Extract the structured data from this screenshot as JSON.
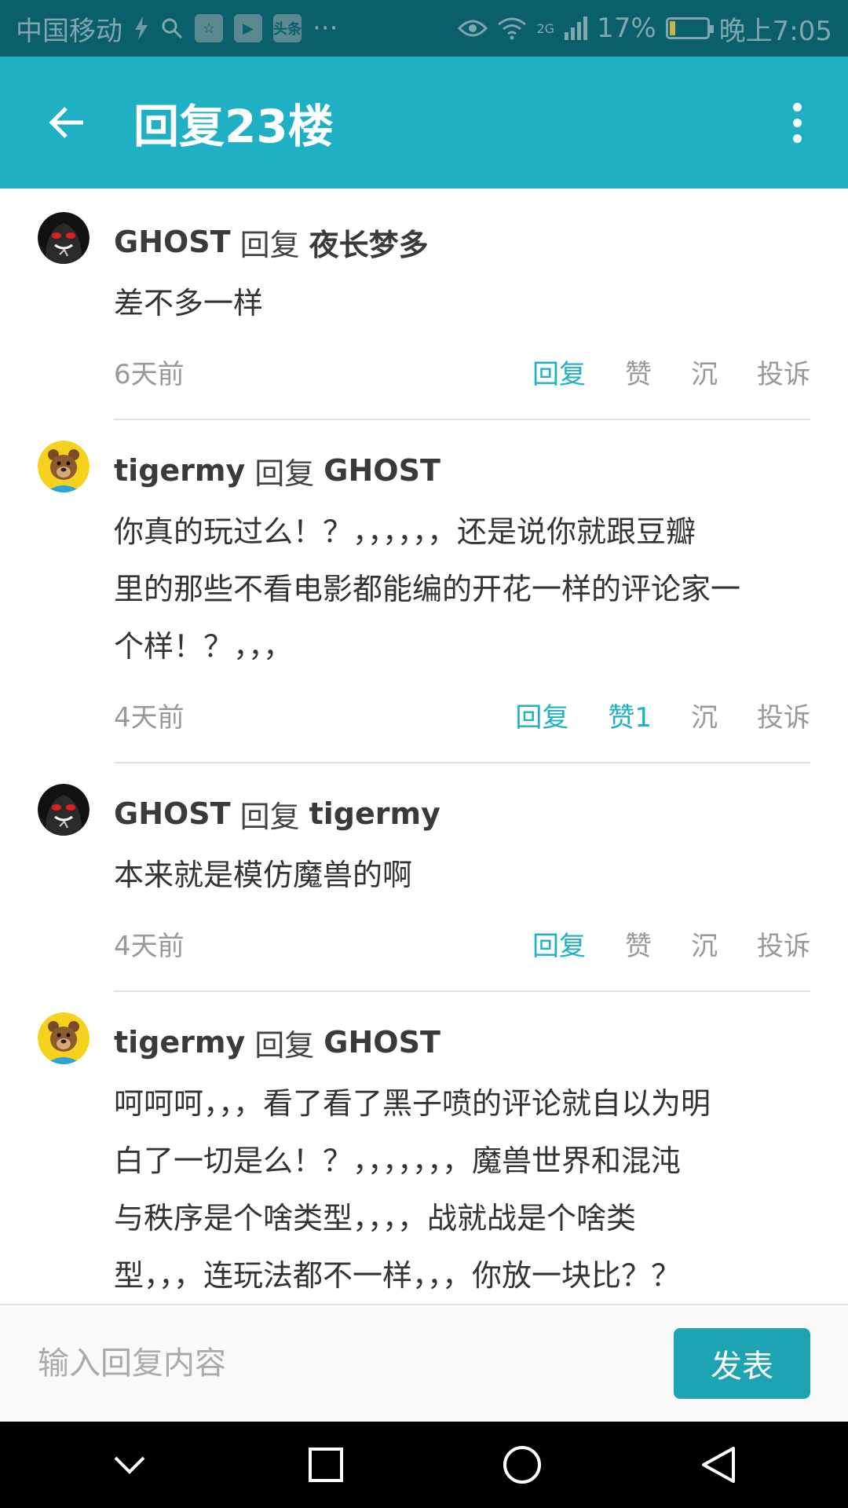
{
  "status_bar": {
    "carrier": "中国移动",
    "app_badges": [
      "☆",
      "▶",
      "头条"
    ],
    "more": "···",
    "network": "2G",
    "battery": "17%",
    "battery_level": 0.17,
    "time": "晚上7:05"
  },
  "header": {
    "title": "回复23楼"
  },
  "comments": [
    {
      "author": "GHOST",
      "reply_word": "回复",
      "target": "夜长梦多",
      "text": "差不多一样",
      "time": "6天前",
      "actions": {
        "reply": "回复",
        "like": "赞",
        "sink": "沉",
        "report": "投诉"
      },
      "like_active": false,
      "avatar": "ghost"
    },
    {
      "author": "tigermy",
      "reply_word": "回复",
      "target": "GHOST",
      "text_lines": [
        "你真的玩过么！？，，，，，，还是说你就跟豆瓣",
        "里的那些不看电影都能编的开花一样的评论家一",
        "个样！？，，，"
      ],
      "time": "4天前",
      "actions": {
        "reply": "回复",
        "like": "赞1",
        "sink": "沉",
        "report": "投诉"
      },
      "like_active": true,
      "avatar": "bear"
    },
    {
      "author": "GHOST",
      "reply_word": "回复",
      "target": "tigermy",
      "text": "本来就是模仿魔兽的啊",
      "time": "4天前",
      "actions": {
        "reply": "回复",
        "like": "赞",
        "sink": "沉",
        "report": "投诉"
      },
      "like_active": false,
      "avatar": "ghost"
    },
    {
      "author": "tigermy",
      "reply_word": "回复",
      "target": "GHOST",
      "text_lines": [
        "呵呵呵，，，看了看了黑子喷的评论就自以为明",
        "白了一切是么！？，，，，，，，魔兽世界和混沌",
        "与秩序是个啥类型，，，，战就战是个啥类",
        "型，，，连玩法都不一样，，，你放一块比？？"
      ],
      "avatar": "bear"
    }
  ],
  "reply_bar": {
    "placeholder": "输入回复内容",
    "submit": "发表"
  },
  "colors": {
    "accent": "#1fb0c3",
    "status_bar": "#0b5f6b",
    "nav_bar": "#000000",
    "muted_text": "#999999"
  },
  "icons": {
    "back": "arrow-left-icon",
    "more": "more-vertical-icon",
    "nav": [
      "chevron-down-icon",
      "square-icon",
      "circle-icon",
      "triangle-back-icon"
    ]
  }
}
